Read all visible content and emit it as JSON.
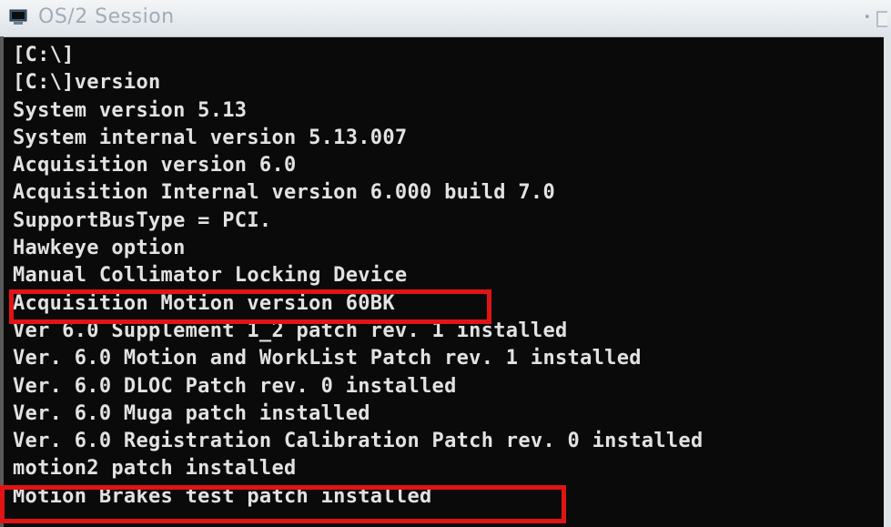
{
  "window": {
    "title": "OS/2 Session",
    "icon": "os2-console-icon",
    "control": "•",
    "colors": {
      "background": "#0a0a0a",
      "text": "#e2e2e2",
      "highlight": "#e01414"
    }
  },
  "console": {
    "lines": [
      "[C:\\]",
      "[C:\\]version",
      "System version 5.13",
      "System internal version 5.13.007",
      "Acquisition version 6.0",
      "Acquisition Internal version 6.000 build 7.0",
      "SupportBusType = PCI.",
      "Hawkeye option",
      "Manual Collimator Locking Device",
      "Acquisition Motion version 60BK",
      "Ver 6.0 Supplement 1_2 patch rev. 1 installed",
      "Ver. 6.0 Motion and WorkList Patch rev. 1 installed",
      "Ver. 6.0 DLOC Patch rev. 0 installed",
      "Ver. 6.0 Muga patch installed",
      "Ver. 6.0 Registration Calibration Patch rev. 0 installed",
      "motion2 patch installed",
      "Motion Brakes test patch installed"
    ]
  }
}
